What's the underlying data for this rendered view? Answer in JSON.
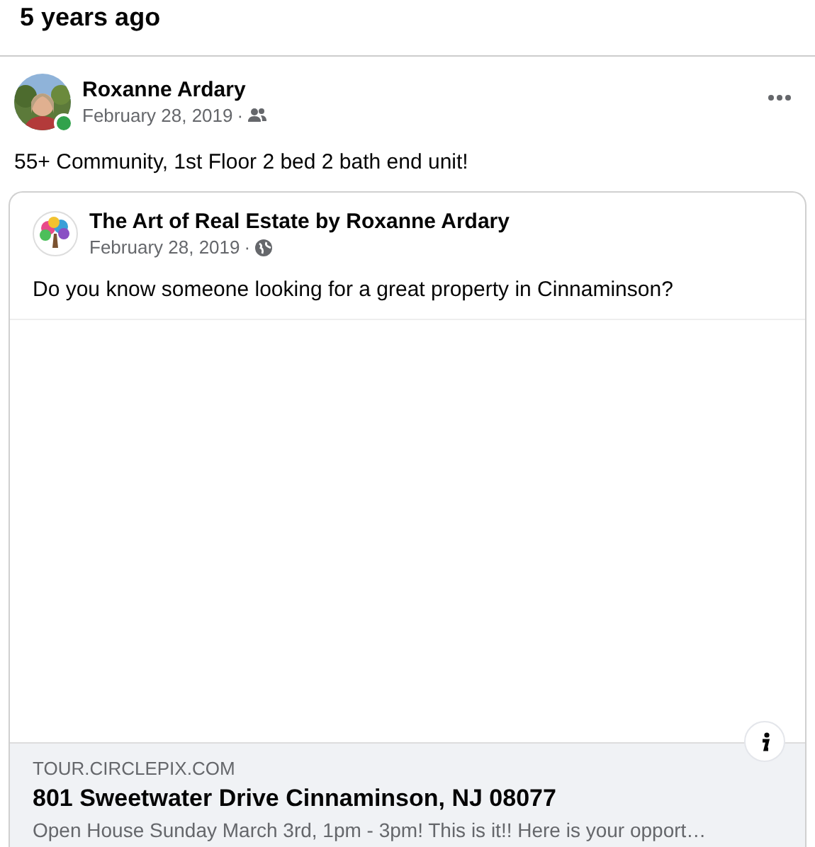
{
  "section_title": "5 years ago",
  "post": {
    "author": "Roxanne Ardary",
    "date": "February 28, 2019",
    "online": true,
    "separator": "·",
    "text": "55+ Community, 1st Floor 2 bed 2 bath end unit!",
    "shared": {
      "author": "The Art of Real Estate by Roxanne Ardary",
      "date": "February 28, 2019",
      "separator": "·",
      "text": "Do you know someone looking for a great property in Cinnaminson?",
      "link": {
        "domain": "TOUR.CIRCLEPIX.COM",
        "title": "801 Sweetwater Drive Cinnaminson, NJ 08077",
        "description": "Open House Sunday March 3rd, 1pm - 3pm! This is it!! Here is your opport…"
      }
    }
  }
}
